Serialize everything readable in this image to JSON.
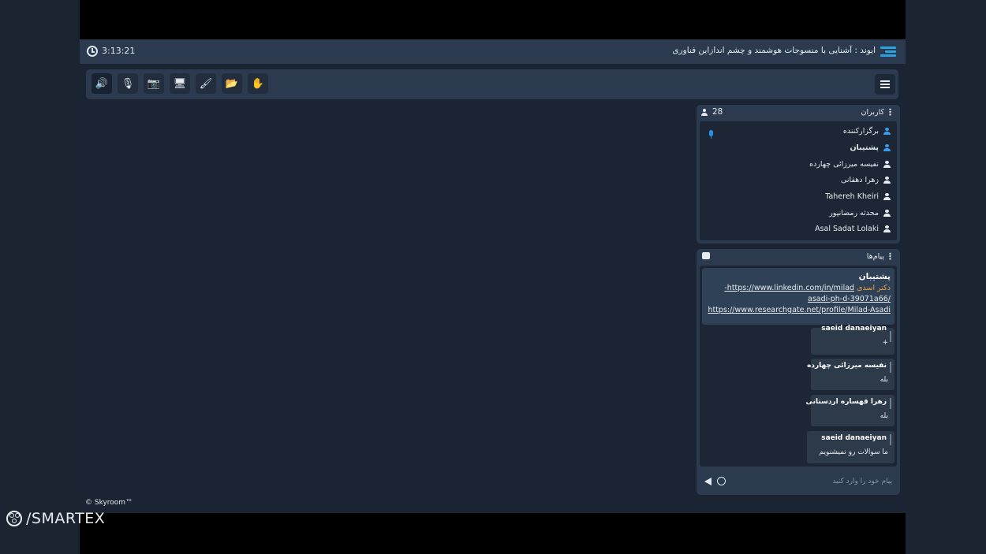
{
  "header": {
    "timer": "3:13:21",
    "title": "ایوند : آشنایی با منسوجات هوشمند و چشم اندازاین فناوری"
  },
  "toolbar": {
    "buttons": [
      {
        "icon": "speaker-icon",
        "glyph": "🔊"
      },
      {
        "icon": "mic-off-icon",
        "glyph": "🎙"
      },
      {
        "icon": "camera-off-icon",
        "glyph": "📷"
      },
      {
        "icon": "screen-share-icon",
        "glyph": "🖥"
      },
      {
        "icon": "brush-icon",
        "glyph": "🖌"
      },
      {
        "icon": "files-icon",
        "glyph": "📂"
      },
      {
        "icon": "raise-hand-icon",
        "glyph": "✋"
      }
    ]
  },
  "users": {
    "label": "کاربران",
    "count": "28",
    "list": [
      {
        "name": "برگزارکننده"
      },
      {
        "name": "پشتیبان"
      },
      {
        "name": "نفیسه میرزائی چهارده"
      },
      {
        "name": "زهرا دهقانی"
      },
      {
        "name": "Tahereh Kheiri"
      },
      {
        "name": "محدثه رمضانپور"
      },
      {
        "name": "Asal Sadat Lolaki"
      }
    ]
  },
  "messages": {
    "label": "پیام‌ها",
    "pinned": {
      "author": "پشتیبان",
      "prefix": "دکتر اسدی",
      "link1a": "https://www.linkedin.com/in/milad-",
      "link1b": "/asadi-ph-d-39071a66",
      "link2": "https://www.researchgate.net/profile/Milad-Asadi"
    },
    "items": [
      {
        "author": "saeid danaeiyan",
        "text": "+"
      },
      {
        "author": "نفیسه میرزائی چهارده",
        "text": "بله"
      },
      {
        "author": "زهرا قهساره اردستانی",
        "text": "بله"
      },
      {
        "author": "saeid danaeiyan",
        "text": "ما سوالات رو نمیشنویم"
      }
    ],
    "input_placeholder": "پیام خود را وارد کنید"
  },
  "footer": {
    "copyright": "© Skyroom™",
    "watermark": "/SMARTEX"
  }
}
